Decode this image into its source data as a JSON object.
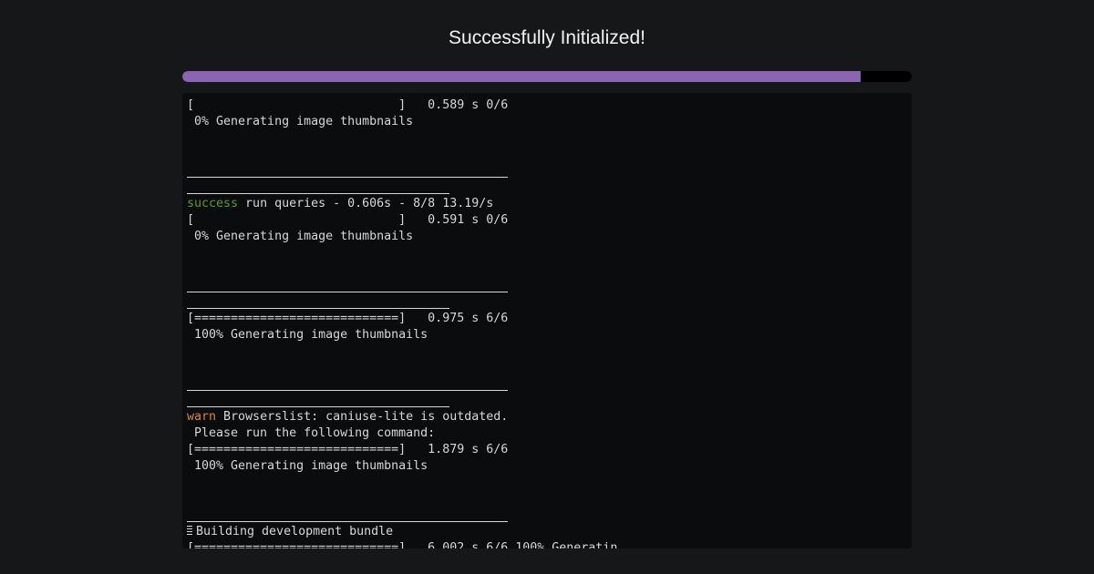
{
  "header": {
    "title": "Successfully Initialized!"
  },
  "progress": {
    "fraction": 0.93,
    "fill_color": "#8c64b4",
    "track_color": "#000000"
  },
  "terminal": {
    "lines": [
      {
        "type": "text",
        "text": "[                            ]   0.589 s 0/6"
      },
      {
        "type": "text",
        "text": " 0% Generating image thumbnails"
      },
      {
        "type": "blank"
      },
      {
        "type": "blank"
      },
      {
        "type": "rule",
        "size": "long"
      },
      {
        "type": "rule",
        "size": "short"
      },
      {
        "type": "status",
        "keyword": "success",
        "text": " run queries - 0.606s - 8/8 13.19/s"
      },
      {
        "type": "text",
        "text": "[                            ]   0.591 s 0/6"
      },
      {
        "type": "text",
        "text": " 0% Generating image thumbnails"
      },
      {
        "type": "blank"
      },
      {
        "type": "blank"
      },
      {
        "type": "rule",
        "size": "long"
      },
      {
        "type": "rule",
        "size": "short"
      },
      {
        "type": "text",
        "text": "[============================]   0.975 s 6/6"
      },
      {
        "type": "text",
        "text": " 100% Generating image thumbnails"
      },
      {
        "type": "blank"
      },
      {
        "type": "blank"
      },
      {
        "type": "rule",
        "size": "long"
      },
      {
        "type": "rule",
        "size": "short"
      },
      {
        "type": "status",
        "keyword": "warn",
        "text": " Browserslist: caniuse-lite is outdated."
      },
      {
        "type": "text",
        "text": " Please run the following command:"
      },
      {
        "type": "text",
        "text": "[============================]   1.879 s 6/6"
      },
      {
        "type": "text",
        "text": " 100% Generating image thumbnails"
      },
      {
        "type": "blank"
      },
      {
        "type": "blank"
      },
      {
        "type": "rule",
        "size": "long"
      },
      {
        "type": "icon",
        "icon": "building-icon",
        "text": "Building development bundle"
      },
      {
        "type": "text",
        "text": "[============================]   6.002 s 6/6 100% Generatin"
      }
    ]
  }
}
